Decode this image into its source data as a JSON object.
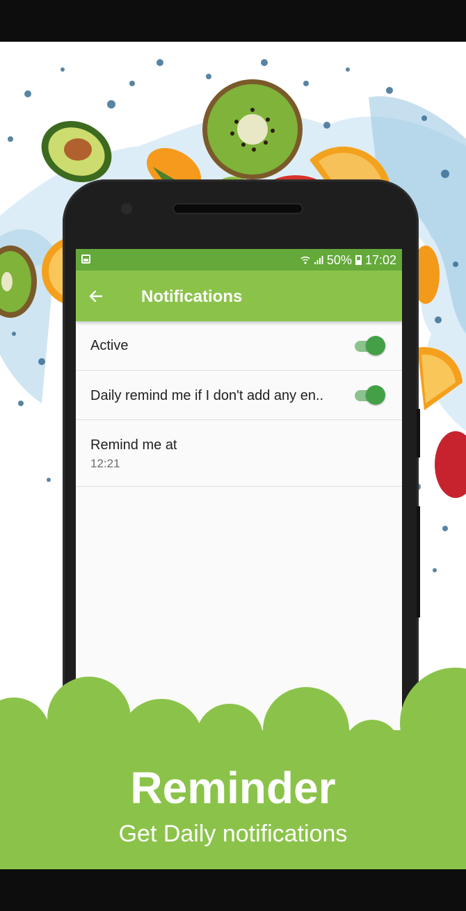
{
  "statusbar": {
    "battery": "50%",
    "time": "17:02"
  },
  "appbar": {
    "title": "Notifications"
  },
  "settings": [
    {
      "label": "Active",
      "toggle_on": true
    },
    {
      "label": "Daily remind me if I don't add any en..",
      "toggle_on": true
    },
    {
      "label": "Remind me at",
      "value": "12:21"
    }
  ],
  "promo": {
    "title": "Reminder",
    "subtitle": "Get Daily notifications"
  },
  "colors": {
    "appbar": "#8bc34a",
    "statusbar": "#64a93a",
    "toggle_on": "#43a047",
    "banner": "#8bc34a"
  }
}
